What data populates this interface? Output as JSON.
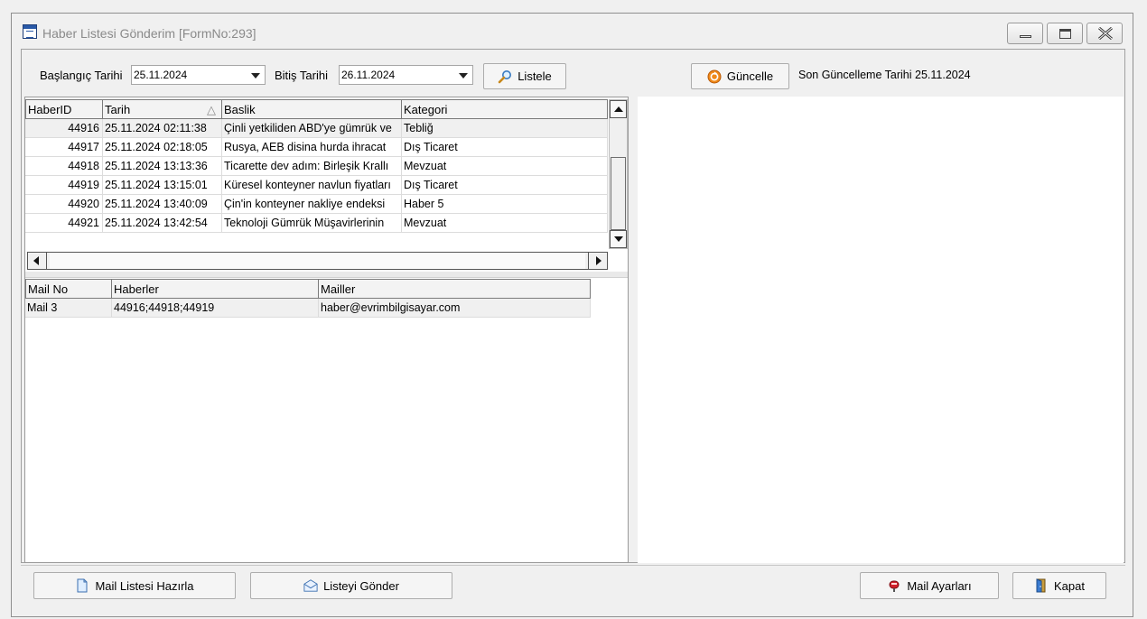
{
  "window": {
    "title": "Haber Listesi Gönderim [FormNo:293]"
  },
  "filters": {
    "start_label": "Başlangıç Tarihi",
    "start_value": "25.11.2024",
    "end_label": "Bitiş Tarihi",
    "end_value": "26.11.2024",
    "list_button": "Listele",
    "update_button": "Güncelle",
    "last_update_label": "Son Güncelleme Tarihi 25.11.2024"
  },
  "news_grid": {
    "columns": [
      "HaberID",
      "Tarih",
      "Baslik",
      "Kategori"
    ],
    "rows": [
      {
        "id": "44916",
        "date": "25.11.2024 02:11:38",
        "title": "Çinli yetkiliden ABD'ye gümrük ve",
        "category": "Tebliğ"
      },
      {
        "id": "44917",
        "date": "25.11.2024 02:18:05",
        "title": "Rusya, AEB disina hurda ihracat",
        "category": "Dış Ticaret"
      },
      {
        "id": "44918",
        "date": "25.11.2024 13:13:36",
        "title": "Ticarette dev adım: Birleşik Krallı",
        "category": "Mevzuat"
      },
      {
        "id": "44919",
        "date": "25.11.2024 13:15:01",
        "title": "Küresel konteyner navlun fiyatları",
        "category": "Dış Ticaret"
      },
      {
        "id": "44920",
        "date": "25.11.2024 13:40:09",
        "title": "Çin'in konteyner nakliye endeksi",
        "category": "Haber 5"
      },
      {
        "id": "44921",
        "date": "25.11.2024 13:42:54",
        "title": "Teknoloji Gümrük Müşavirlerinin",
        "category": "Mevzuat"
      }
    ]
  },
  "mail_grid": {
    "columns": [
      "Mail No",
      "Haberler",
      "Mailler"
    ],
    "rows": [
      {
        "no": "Mail 3",
        "news": "44916;44918;44919",
        "mail": "haber@evrimbilgisayar.com"
      }
    ]
  },
  "footer": {
    "prepare_button": "Mail Listesi Hazırla",
    "send_button": "Listeyi Gönder",
    "settings_button": "Mail Ayarları",
    "close_button": "Kapat"
  },
  "icons": {
    "list": "magnifier-icon",
    "update": "refresh-icon",
    "prepare": "document-icon",
    "send": "envelope-icon",
    "settings": "mailbox-icon",
    "close": "door-exit-icon"
  }
}
